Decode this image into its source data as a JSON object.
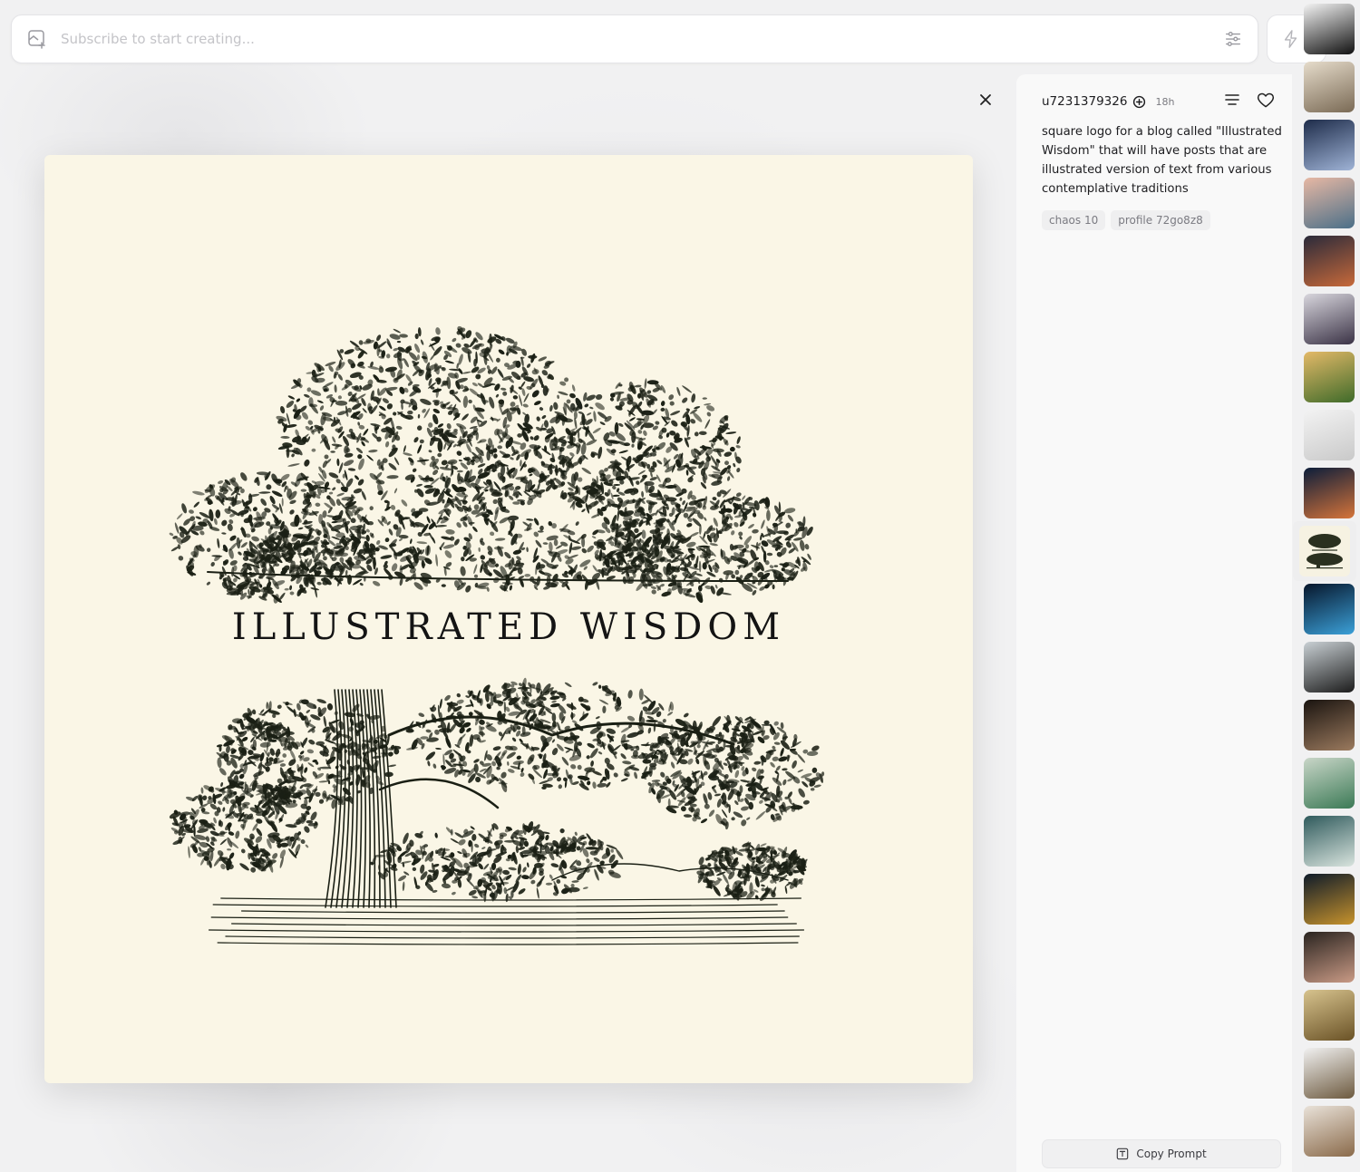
{
  "prompt_bar": {
    "placeholder": "Subscribe to start creating..."
  },
  "image": {
    "title": "ILLUSTRATED WISDOM",
    "background": "#faf6e6",
    "ink": "#1a1f14"
  },
  "post": {
    "username": "u7231379326",
    "time": "18h",
    "prompt": "square logo for a blog called \"Illustrated Wisdom\" that will have posts that are illustrated version of text from various contemplative traditions",
    "tags": [
      "chaos 10",
      "profile 72go8z8"
    ],
    "copy_label": "Copy Prompt"
  },
  "thumbnails": [
    {
      "icon": "abstract-gradient-thumb",
      "c1": "#f4f4f4",
      "c2": "#111111"
    },
    {
      "icon": "still-life-thumb",
      "c1": "#e6dccb",
      "c2": "#7a6a55"
    },
    {
      "icon": "fantasy-portrait-thumb",
      "c1": "#1e2c4a",
      "c2": "#9fb3d6"
    },
    {
      "icon": "girl-painting-thumb",
      "c1": "#e7b8a4",
      "c2": "#4b6f88"
    },
    {
      "icon": "witch-thumb",
      "c1": "#2a2a3a",
      "c2": "#c7693a"
    },
    {
      "icon": "cloaked-figure-thumb",
      "c1": "#d8d6dd",
      "c2": "#3b3346"
    },
    {
      "icon": "landscape-sunset-thumb",
      "c1": "#e4b968",
      "c2": "#3f6b2a"
    },
    {
      "icon": "white-minimal-thumb",
      "c1": "#f3f3f3",
      "c2": "#c9c9c9"
    },
    {
      "icon": "nebula-thumb",
      "c1": "#0c1d3a",
      "c2": "#d5743a"
    },
    {
      "icon": "illustrated-wisdom-thumb",
      "c1": "#f6f2e2",
      "c2": "#2a3020"
    },
    {
      "icon": "cosmic-face-thumb",
      "c1": "#07162b",
      "c2": "#3ba0d8"
    },
    {
      "icon": "road-scene-thumb",
      "c1": "#c9d0d4",
      "c2": "#1c1c1c"
    },
    {
      "icon": "dark-portrait-thumb",
      "c1": "#1a1410",
      "c2": "#9b7a5e"
    },
    {
      "icon": "green-hair-thumb",
      "c1": "#c9d6c8",
      "c2": "#3c7a56"
    },
    {
      "icon": "forest-abstract-thumb",
      "c1": "#2f5a5c",
      "c2": "#d9e4de"
    },
    {
      "icon": "planet-badge-thumb",
      "c1": "#0f1b2a",
      "c2": "#c6922c"
    },
    {
      "icon": "man-portrait-thumb",
      "c1": "#2a2420",
      "c2": "#c99a85"
    },
    {
      "icon": "golden-plant-thumb",
      "c1": "#d7c38e",
      "c2": "#6a5226"
    },
    {
      "icon": "rock-sculpture-thumb",
      "c1": "#f1f1f1",
      "c2": "#6d5a3f"
    },
    {
      "icon": "dog-portrait-thumb",
      "c1": "#e9e2d9",
      "c2": "#8a6a4a"
    }
  ]
}
